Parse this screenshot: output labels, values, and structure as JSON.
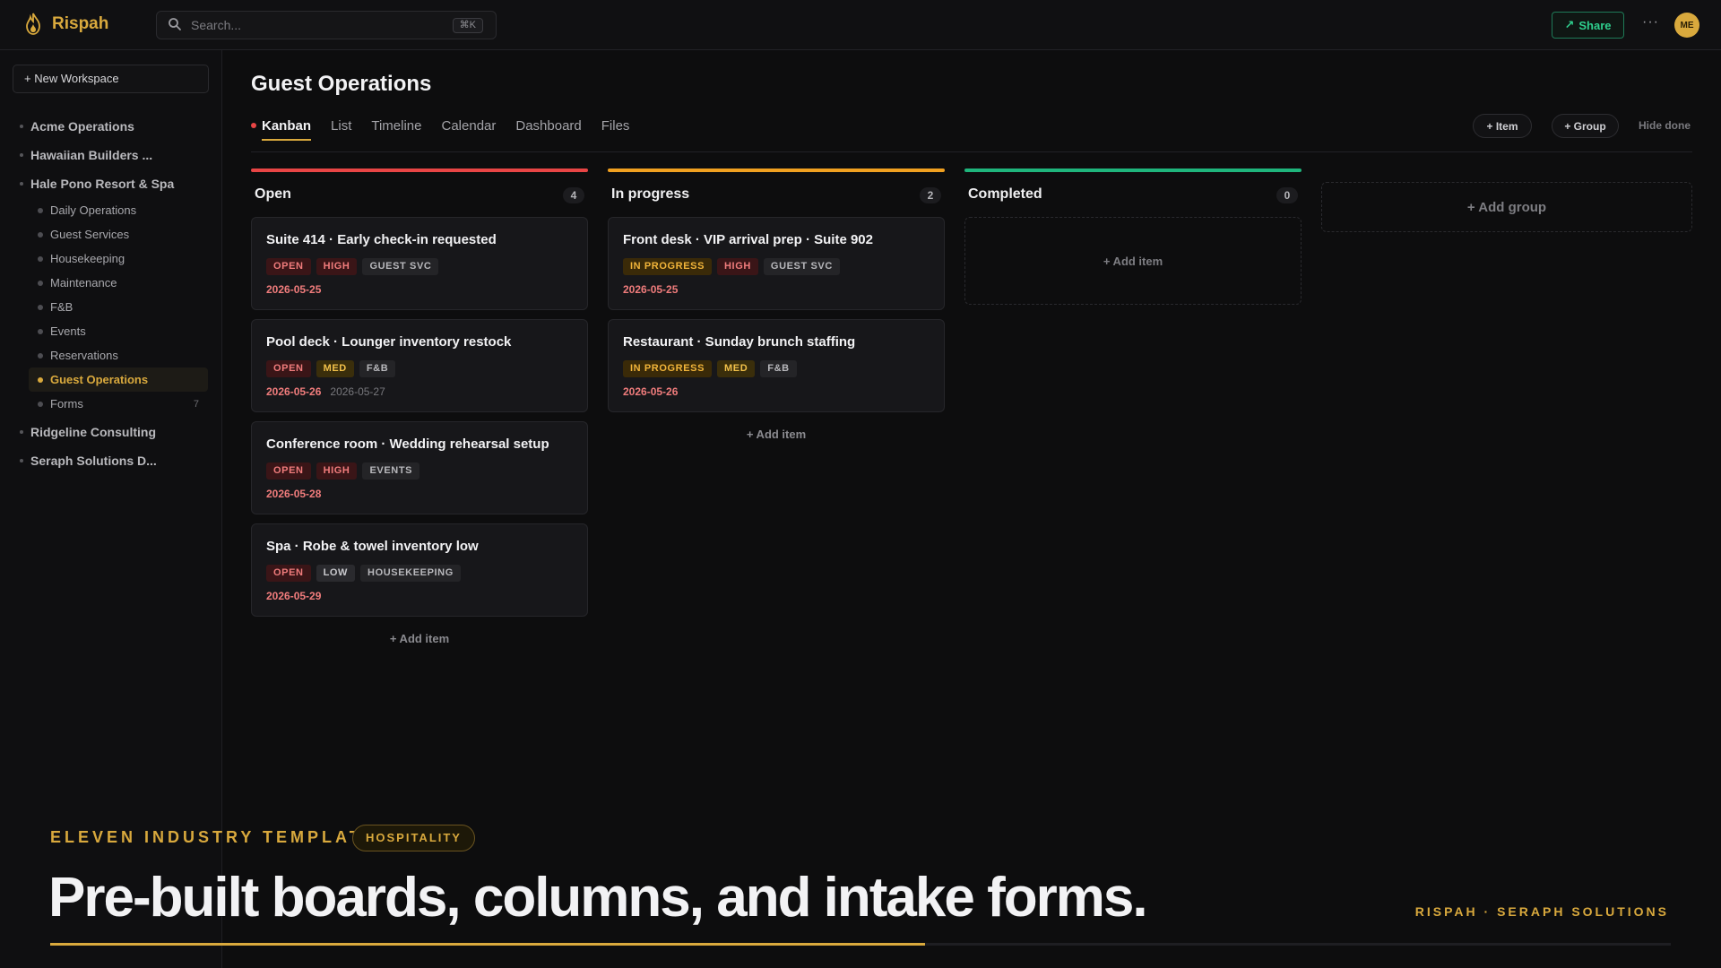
{
  "app": {
    "name": "Rispah"
  },
  "topbar": {
    "search_placeholder": "Search...",
    "search_shortcut": "⌘K",
    "share_label": "Share",
    "more_label": "···",
    "avatar_initials": "ME"
  },
  "sidebar": {
    "new_workspace_label": "+ New Workspace",
    "workspaces": [
      {
        "label": "Acme Operations"
      },
      {
        "label": "Hawaiian Builders ..."
      },
      {
        "label": "Hale Pono Resort & Spa"
      }
    ],
    "boards": [
      {
        "label": "Daily Operations"
      },
      {
        "label": "Guest Services"
      },
      {
        "label": "Housekeeping"
      },
      {
        "label": "Maintenance"
      },
      {
        "label": "F&B"
      },
      {
        "label": "Events"
      },
      {
        "label": "Reservations"
      },
      {
        "label": "Guest Operations",
        "active": true
      },
      {
        "label": "Forms",
        "count": "7"
      }
    ],
    "more_workspaces": [
      {
        "label": "Ridgeline Consulting"
      },
      {
        "label": "Seraph Solutions D..."
      }
    ]
  },
  "main": {
    "title": "Guest Operations",
    "tabs": [
      "Kanban",
      "List",
      "Timeline",
      "Calendar",
      "Dashboard",
      "Files"
    ],
    "active_tab": "Kanban",
    "add_item_btn": "+ Item",
    "add_group_btn": "+ Group",
    "hide_done": "Hide done",
    "add_item_label": "+ Add item",
    "add_group_label": "+ Add group",
    "columns": [
      {
        "title": "Open",
        "count": "4",
        "color": "#e84545",
        "cards": [
          {
            "title": "Suite 414 · Early check-in requested",
            "tags": [
              [
                "OPEN",
                "open"
              ],
              [
                "HIGH",
                "high"
              ],
              [
                "GUEST SVC",
                "cat"
              ]
            ],
            "due": "2026-05-25",
            "end": ""
          },
          {
            "title": "Pool deck · Lounger inventory restock",
            "tags": [
              [
                "OPEN",
                "open"
              ],
              [
                "MED",
                "med"
              ],
              [
                "F&B",
                "cat"
              ]
            ],
            "due": "2026-05-26",
            "end": "2026-05-27"
          },
          {
            "title": "Conference room · Wedding rehearsal setup",
            "tags": [
              [
                "OPEN",
                "open"
              ],
              [
                "HIGH",
                "high"
              ],
              [
                "EVENTS",
                "cat"
              ]
            ],
            "due": "2026-05-28",
            "end": ""
          },
          {
            "title": "Spa · Robe & towel inventory low",
            "tags": [
              [
                "OPEN",
                "open"
              ],
              [
                "LOW",
                "low"
              ],
              [
                "HOUSEKEEPING",
                "cat"
              ]
            ],
            "due": "2026-05-29",
            "end": ""
          }
        ]
      },
      {
        "title": "In progress",
        "count": "2",
        "color": "#f0a020",
        "cards": [
          {
            "title": "Front desk · VIP arrival prep · Suite 902",
            "tags": [
              [
                "IN PROGRESS",
                "progress"
              ],
              [
                "HIGH",
                "high"
              ],
              [
                "GUEST SVC",
                "cat"
              ]
            ],
            "due": "2026-05-25",
            "end": ""
          },
          {
            "title": "Restaurant · Sunday brunch staffing",
            "tags": [
              [
                "IN PROGRESS",
                "progress"
              ],
              [
                "MED",
                "med"
              ],
              [
                "F&B",
                "cat"
              ]
            ],
            "due": "2026-05-26",
            "end": ""
          }
        ]
      },
      {
        "title": "Completed",
        "count": "0",
        "color": "#1fb57c",
        "cards": []
      }
    ]
  },
  "banner": {
    "kicker": "ELEVEN INDUSTRY TEMPLATES",
    "pill": "HOSPITALITY",
    "headline": "Pre-built boards, columns, and intake forms.",
    "credit": "RISPAH · SERAPH SOLUTIONS",
    "progress": 0.54
  }
}
